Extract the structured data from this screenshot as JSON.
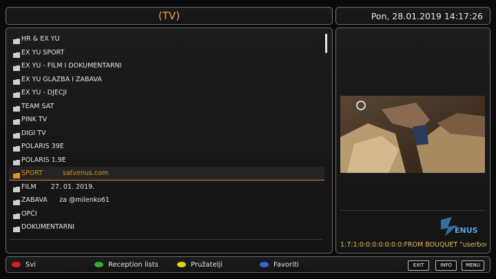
{
  "header": {
    "title": "(TV)",
    "datetime": "Pon, 28.01.2019  14:17:26"
  },
  "bouquets": [
    {
      "label": "HR & EX YU",
      "extra": ""
    },
    {
      "label": "EX YU   SPORT",
      "extra": ""
    },
    {
      "label": "EX YU - FILM I DOKUMENTARNI",
      "extra": ""
    },
    {
      "label": "EX YU   GLAZBA I ZABAVA",
      "extra": ""
    },
    {
      "label": "EX YU - DJECJI",
      "extra": ""
    },
    {
      "label": "TEAM SAT",
      "extra": ""
    },
    {
      "label": "PINK TV",
      "extra": ""
    },
    {
      "label": "DIGI TV",
      "extra": ""
    },
    {
      "label": "POLARIS 39E",
      "extra": ""
    },
    {
      "label": "POLARIS 1.9E",
      "extra": ""
    },
    {
      "label": "SPORT",
      "extra": "satvenus.com",
      "selected": true
    },
    {
      "label": "FILM",
      "extra": "27. 01. 2019."
    },
    {
      "label": "ZABAVA",
      "extra": "za @milenko61"
    },
    {
      "label": "OPĆI",
      "extra": ""
    },
    {
      "label": "DOKUMENTARNI",
      "extra": ""
    }
  ],
  "preview": {
    "service_ref": "1:7:1:0:0:0:0:0:0:0:FROM BOUQUET \"userbou",
    "logo_text": "ENUS"
  },
  "buttons": {
    "red": {
      "label": "Svi",
      "color": "#d81e1e"
    },
    "green": {
      "label": "Reception lists",
      "color": "#2fae2f"
    },
    "yellow": {
      "label": "Pružatelji",
      "color": "#e0d21c"
    },
    "blue": {
      "label": "Favoriti",
      "color": "#3a63d6"
    },
    "exit": "EXIT",
    "info": "INFO",
    "menu": "MENU"
  },
  "colors": {
    "accent": "#e7a53b",
    "selected_text": "#e0951e"
  }
}
